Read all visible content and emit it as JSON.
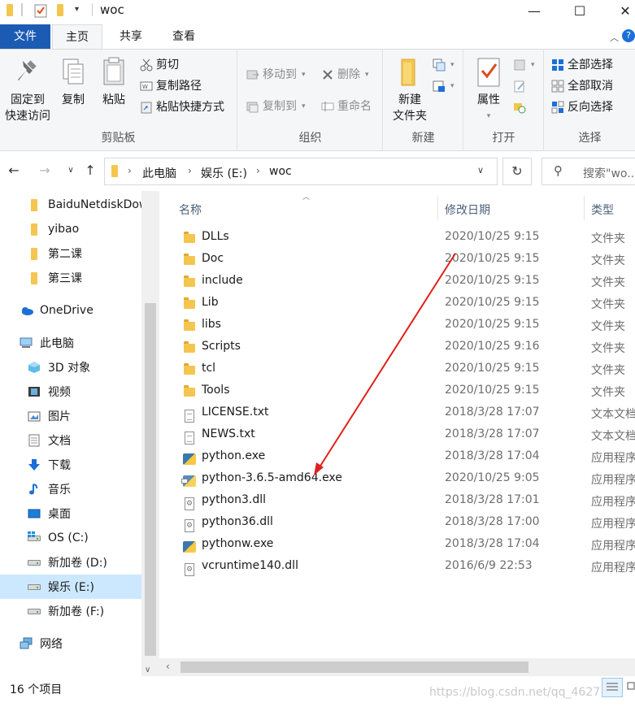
{
  "window": {
    "title": "woc",
    "minimize": "—",
    "maximize": "☐",
    "close": "✕"
  },
  "ribbon_tabs": [
    "文件",
    "主页",
    "共享",
    "查看"
  ],
  "ribbon": {
    "clipboard": {
      "pin_label_1": "固定到",
      "pin_label_2": "快速访问",
      "copy": "复制",
      "paste": "粘贴",
      "cut": "剪切",
      "copy_path": "复制路径",
      "paste_shortcut": "粘贴快捷方式",
      "group": "剪贴板"
    },
    "organize": {
      "move_to": "移动到",
      "copy_to": "复制到",
      "delete": "删除",
      "rename": "重命名",
      "group": "组织"
    },
    "new": {
      "new_folder_1": "新建",
      "new_folder_2": "文件夹",
      "group": "新建"
    },
    "open": {
      "properties": "属性",
      "group": "打开"
    },
    "select": {
      "select_all": "全部选择",
      "select_none": "全部取消",
      "invert": "反向选择",
      "group": "选择"
    }
  },
  "address": {
    "crumbs": [
      "此电脑",
      "娱乐 (E:)",
      "woc"
    ],
    "search_placeholder": "搜索\"wo..."
  },
  "nav_pane": {
    "quick": [
      "BaiduNetdiskDownload",
      "yibao",
      "第二课",
      "第三课"
    ],
    "onedrive": "OneDrive",
    "this_pc": "此电脑",
    "pc_items": [
      "3D 对象",
      "视频",
      "图片",
      "文档",
      "下载",
      "音乐",
      "桌面",
      "OS (C:)",
      "新加卷 (D:)",
      "娱乐 (E:)",
      "新加卷 (F:)"
    ],
    "network": "网络"
  },
  "columns": {
    "name": "名称",
    "date": "修改日期",
    "type": "类型"
  },
  "files": [
    {
      "name": "DLLs",
      "date": "2020/10/25 9:15",
      "type": "文件夹",
      "icon": "folder-icon"
    },
    {
      "name": "Doc",
      "date": "2020/10/25 9:15",
      "type": "文件夹",
      "icon": "folder-icon"
    },
    {
      "name": "include",
      "date": "2020/10/25 9:15",
      "type": "文件夹",
      "icon": "folder-icon"
    },
    {
      "name": "Lib",
      "date": "2020/10/25 9:15",
      "type": "文件夹",
      "icon": "folder-icon"
    },
    {
      "name": "libs",
      "date": "2020/10/25 9:15",
      "type": "文件夹",
      "icon": "folder-icon"
    },
    {
      "name": "Scripts",
      "date": "2020/10/25 9:16",
      "type": "文件夹",
      "icon": "folder-icon"
    },
    {
      "name": "tcl",
      "date": "2020/10/25 9:15",
      "type": "文件夹",
      "icon": "folder-icon"
    },
    {
      "name": "Tools",
      "date": "2020/10/25 9:15",
      "type": "文件夹",
      "icon": "folder-icon"
    },
    {
      "name": "LICENSE.txt",
      "date": "2018/3/28 17:07",
      "type": "文本文档",
      "icon": "text-file-icon"
    },
    {
      "name": "NEWS.txt",
      "date": "2018/3/28 17:07",
      "type": "文本文档",
      "icon": "text-file-icon"
    },
    {
      "name": "python.exe",
      "date": "2018/3/28 17:04",
      "type": "应用程序",
      "icon": "python-exe-icon"
    },
    {
      "name": "python-3.6.5-amd64.exe",
      "date": "2020/10/25 9:05",
      "type": "应用程序",
      "icon": "python-installer-icon"
    },
    {
      "name": "python3.dll",
      "date": "2018/3/28 17:01",
      "type": "应用程序扩展",
      "icon": "dll-icon"
    },
    {
      "name": "python36.dll",
      "date": "2018/3/28 17:00",
      "type": "应用程序扩展",
      "icon": "dll-icon"
    },
    {
      "name": "pythonw.exe",
      "date": "2018/3/28 17:04",
      "type": "应用程序",
      "icon": "python-exe-icon"
    },
    {
      "name": "vcruntime140.dll",
      "date": "2016/6/9 22:53",
      "type": "应用程序扩展",
      "icon": "dll-icon"
    }
  ],
  "status": {
    "item_count": "16 个项目"
  },
  "watermark": "https://blog.csdn.net/qq_4627",
  "colors": {
    "accent": "#1c5bb4",
    "annotation_arrow": "#e0201b",
    "selected": "#cce8ff"
  }
}
